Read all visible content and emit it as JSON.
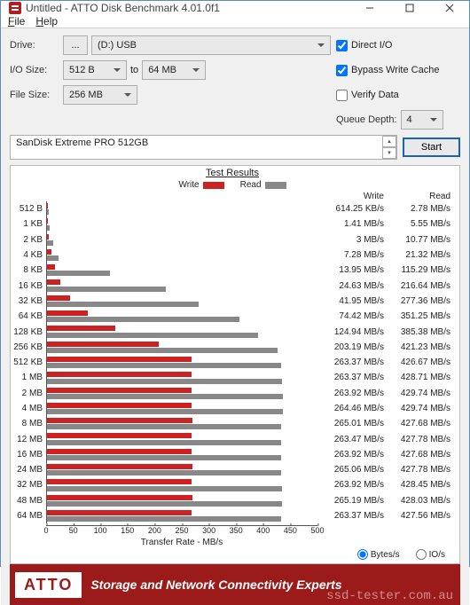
{
  "window": {
    "title": "Untitled - ATTO Disk Benchmark 4.01.0f1",
    "menu": {
      "file": "File",
      "help": "Help"
    }
  },
  "config": {
    "drive_label": "Drive:",
    "drive_browse": "...",
    "drive_value": "(D:) USB",
    "io_label": "I/O Size:",
    "io_min": "512 B",
    "io_to": "to",
    "io_max": "64 MB",
    "filesize_label": "File Size:",
    "filesize_value": "256 MB",
    "direct_io": "Direct I/O",
    "direct_io_checked": true,
    "bypass": "Bypass Write Cache",
    "bypass_checked": true,
    "verify": "Verify Data",
    "verify_checked": false,
    "queue_label": "Queue Depth:",
    "queue_value": "4",
    "description": "SanDisk Extreme PRO 512GB",
    "start": "Start"
  },
  "results": {
    "title": "Test Results",
    "legend": {
      "write": "Write",
      "read": "Read"
    },
    "colors": {
      "write": "#cc2222",
      "read": "#888888"
    },
    "header_write": "Write",
    "header_read": "Read",
    "units": {
      "bytes": "Bytes/s",
      "ios": "IO/s",
      "selected": "bytes"
    }
  },
  "chart_data": {
    "type": "bar",
    "orientation": "horizontal",
    "series_unit_label": {
      "KBps": "KB/s",
      "MBps": "MB/s"
    },
    "xlabel": "Transfer Rate - MB/s",
    "xlim": [
      0,
      500
    ],
    "xticks": [
      0,
      50,
      100,
      150,
      200,
      250,
      300,
      350,
      400,
      450,
      500
    ],
    "rows": [
      {
        "label": "512 B",
        "write_v": 614.25,
        "write_u": "KB/s",
        "read_v": 2.78,
        "read_u": "MB/s"
      },
      {
        "label": "1 KB",
        "write_v": 1.41,
        "write_u": "MB/s",
        "read_v": 5.55,
        "read_u": "MB/s"
      },
      {
        "label": "2 KB",
        "write_v": 3,
        "write_u": "MB/s",
        "read_v": 10.77,
        "read_u": "MB/s"
      },
      {
        "label": "4 KB",
        "write_v": 7.28,
        "write_u": "MB/s",
        "read_v": 21.32,
        "read_u": "MB/s"
      },
      {
        "label": "8 KB",
        "write_v": 13.95,
        "write_u": "MB/s",
        "read_v": 115.29,
        "read_u": "MB/s"
      },
      {
        "label": "16 KB",
        "write_v": 24.63,
        "write_u": "MB/s",
        "read_v": 216.64,
        "read_u": "MB/s"
      },
      {
        "label": "32 KB",
        "write_v": 41.95,
        "write_u": "MB/s",
        "read_v": 277.36,
        "read_u": "MB/s"
      },
      {
        "label": "64 KB",
        "write_v": 74.42,
        "write_u": "MB/s",
        "read_v": 351.25,
        "read_u": "MB/s"
      },
      {
        "label": "128 KB",
        "write_v": 124.94,
        "write_u": "MB/s",
        "read_v": 385.38,
        "read_u": "MB/s"
      },
      {
        "label": "256 KB",
        "write_v": 203.19,
        "write_u": "MB/s",
        "read_v": 421.23,
        "read_u": "MB/s"
      },
      {
        "label": "512 KB",
        "write_v": 263.37,
        "write_u": "MB/s",
        "read_v": 426.67,
        "read_u": "MB/s"
      },
      {
        "label": "1 MB",
        "write_v": 263.37,
        "write_u": "MB/s",
        "read_v": 428.71,
        "read_u": "MB/s"
      },
      {
        "label": "2 MB",
        "write_v": 263.92,
        "write_u": "MB/s",
        "read_v": 429.74,
        "read_u": "MB/s"
      },
      {
        "label": "4 MB",
        "write_v": 264.46,
        "write_u": "MB/s",
        "read_v": 429.74,
        "read_u": "MB/s"
      },
      {
        "label": "8 MB",
        "write_v": 265.01,
        "write_u": "MB/s",
        "read_v": 427.68,
        "read_u": "MB/s"
      },
      {
        "label": "12 MB",
        "write_v": 263.47,
        "write_u": "MB/s",
        "read_v": 427.78,
        "read_u": "MB/s"
      },
      {
        "label": "16 MB",
        "write_v": 263.92,
        "write_u": "MB/s",
        "read_v": 427.68,
        "read_u": "MB/s"
      },
      {
        "label": "24 MB",
        "write_v": 265.06,
        "write_u": "MB/s",
        "read_v": 427.78,
        "read_u": "MB/s"
      },
      {
        "label": "32 MB",
        "write_v": 263.92,
        "write_u": "MB/s",
        "read_v": 428.45,
        "read_u": "MB/s"
      },
      {
        "label": "48 MB",
        "write_v": 265.19,
        "write_u": "MB/s",
        "read_v": 428.03,
        "read_u": "MB/s"
      },
      {
        "label": "64 MB",
        "write_v": 263.37,
        "write_u": "MB/s",
        "read_v": 427.56,
        "read_u": "MB/s"
      }
    ]
  },
  "footer": {
    "brand": "ATTO",
    "tagline": "Storage and Network Connectivity Experts",
    "watermark": "ssd-tester.com.au"
  }
}
